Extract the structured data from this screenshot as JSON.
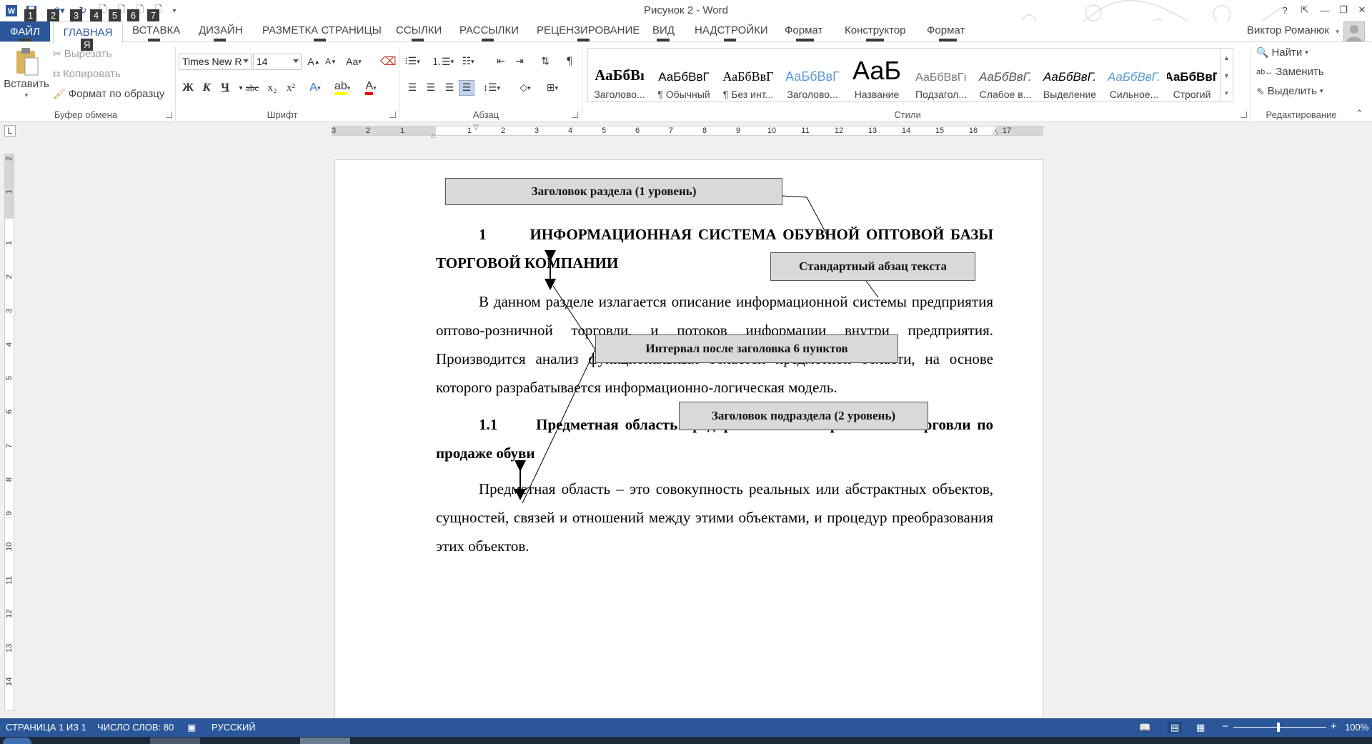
{
  "window": {
    "title": "Рисунок 2 - Word",
    "help": "?"
  },
  "qat": {
    "keytips": [
      "1",
      "2",
      "3",
      "4",
      "5",
      "6",
      "7"
    ]
  },
  "tabs": {
    "file": "ФАЙЛ",
    "home": "ГЛАВНАЯ",
    "items": [
      "ВСТАВКА",
      "ДИЗАЙН",
      "РАЗМЕТКА СТРАНИЦЫ",
      "ССЫЛКИ",
      "РАССЫЛКИ",
      "РЕЦЕНЗИРОВАНИЕ",
      "ВИД",
      "НАДСТРОЙКИ",
      "Формат",
      "Конструктор",
      "Формат"
    ],
    "keytips": [
      "Ф",
      "Я",
      "С",
      "Д",
      "З",
      "К",
      "Л",
      "И",
      "О",
      "Н",
      "Э1",
      "Э2",
      "Э3"
    ]
  },
  "user": {
    "name": "Виктор Романюк"
  },
  "clipboard": {
    "paste": "Вставить",
    "cut": "Вырезать",
    "copy": "Копировать",
    "format_painter": "Формат по образцу",
    "label": "Буфер обмена"
  },
  "font": {
    "family": "Times New R",
    "size": "14",
    "grow": "A",
    "shrink": "A",
    "case": "Aa",
    "bold": "Ж",
    "italic": "К",
    "underline": "Ч",
    "strike": "abc",
    "subscript": "x₂",
    "superscript": "x²",
    "label": "Шрифт"
  },
  "paragraph": {
    "label": "Абзац",
    "pilcrow": "¶"
  },
  "styles": {
    "label": "Стили",
    "items": [
      {
        "sample": "АаБбВı",
        "name": "Заголово..."
      },
      {
        "sample": "АаБбВвГ",
        "name": "¶ Обычный"
      },
      {
        "sample": "АаБбВвГ",
        "name": "¶ Без инт..."
      },
      {
        "sample": "АаБбВвГ",
        "name": "Заголово..."
      },
      {
        "sample": "АаБ",
        "name": "Название"
      },
      {
        "sample": "АаБбВвГı",
        "name": "Подзагол..."
      },
      {
        "sample": "АаБбВвГ.",
        "name": "Слабое в..."
      },
      {
        "sample": "АаБбВвГ.",
        "name": "Выделение"
      },
      {
        "sample": "АаБбВвГ.",
        "name": "Сильное..."
      },
      {
        "sample": "АаБбВвГ",
        "name": "Строгий"
      }
    ]
  },
  "editing": {
    "find": "Найти",
    "replace": "Заменить",
    "select": "Выделить",
    "label": "Редактирование"
  },
  "ruler": {
    "corner": "L",
    "h_numbers": [
      "3",
      "2",
      "1",
      "1",
      "2",
      "3",
      "4",
      "5",
      "6",
      "7",
      "8",
      "9",
      "10",
      "11",
      "12",
      "13",
      "14",
      "15",
      "16",
      "17"
    ],
    "v_numbers": [
      "2",
      "1",
      "1",
      "2",
      "3",
      "4",
      "5",
      "6",
      "7",
      "8",
      "9",
      "10",
      "11",
      "12",
      "13",
      "14"
    ]
  },
  "document": {
    "h1_num": "1",
    "h1_text": "ИНФОРМАЦИОННАЯ СИСТЕМА ОБУВНОЙ ОПТОВОЙ БАЗЫ ТОРГОВОЙ КОМПАНИИ",
    "p1": "В данном разделе излагается описание информационной системы предприятия оптово-розничной торговли, и потоков информации внутри предприятия. Производится анализ функциональных областей предметной области, на основе которого разрабатывается информационно-логическая модель.",
    "h2_num": "1.1",
    "h2_text": "Предметная область предприятия оптово-розничной торговли по продаже обуви",
    "p2": "Предметная область – это совокупность реальных или абстрактных объектов, сущностей, связей и отношений между этими объектами, и процедур преобразования этих объектов."
  },
  "callouts": {
    "heading1": "Заголовок раздела (1 уровень)",
    "paragraph": "Стандартный абзац текста",
    "spacing": "Интервал после заголовка 6 пунктов",
    "heading2": "Заголовок подраздела (2 уровень)"
  },
  "status": {
    "page": "СТРАНИЦА 1 ИЗ 1",
    "words": "ЧИСЛО СЛОВ: 80",
    "language": "РУССКИЙ",
    "zoom": "100%",
    "minus": "−",
    "plus": "+"
  },
  "colors": {
    "accent": "#2b579a",
    "callout_fill": "#d9d9d9"
  }
}
